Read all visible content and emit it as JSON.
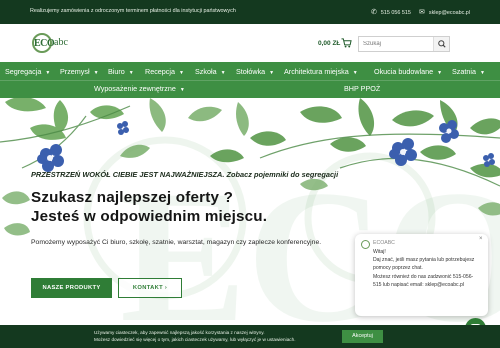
{
  "topbar": {
    "promo": "Realizujemy zamówienia z odroczonym terminem płatności dla instytucji państwowych",
    "phone": "515 056 515",
    "email": "sklep@ecoabc.pl",
    "phone_icon": "phone-icon",
    "email_icon": "envelope-icon"
  },
  "header": {
    "logo_mark": "ECO",
    "logo_suffix": "abc",
    "cart_total": "0,00 ZŁ",
    "cart_icon": "cart-icon",
    "search_placeholder": "Szukaj",
    "search_icon": "search-icon"
  },
  "nav": {
    "row1": [
      {
        "label": "Segregacja",
        "has_caret": true
      },
      {
        "label": "Przemysł",
        "has_caret": true
      },
      {
        "label": "Biuro",
        "has_caret": true
      },
      {
        "label": "Recepcja",
        "has_caret": true
      },
      {
        "label": "Szkoła",
        "has_caret": true
      },
      {
        "label": "Stołówka",
        "has_caret": true
      },
      {
        "label": "Architektura miejska",
        "has_caret": true
      },
      {
        "label": "Okucia budowlane",
        "has_caret": true
      },
      {
        "label": "Szatnia",
        "has_caret": true
      }
    ],
    "row2": [
      {
        "label": "Wyposażenie zewnętrzne",
        "has_caret": true
      },
      {
        "label": "BHP PPOŻ",
        "has_caret": false
      }
    ]
  },
  "hero": {
    "tagline": "PRZESTRZEŃ WOKÓŁ CIEBIE JEST NAJWAŻNIEJSZA. Zobacz pojemniki do segregacji",
    "heading_line1": "Szukasz najlepszej oferty ?",
    "heading_line2": "Jesteś w odpowiednim miejscu.",
    "subtitle": "Pomożemy wyposażyć Ci biuro, szkołę, szatnie, warsztat, magazyn czy zaplecze konferencyjne.",
    "primary_button": "NASZE PRODUKTY",
    "secondary_button": "KONTAKT",
    "secondary_button_icon": "chevron-right-icon",
    "watermark": "ECOabc"
  },
  "chat": {
    "sender": "ECOABC",
    "close_icon": "close-icon",
    "message": "Witaj!\nDaj znać, jeśli masz pytania lub potrzebujesz pomocy poprzez chat.\nMożesz również do nas zadzwonić 515-056-515 lub napisać email: sklep@ecoabc.pl",
    "fab_icon": "chat-bubble-icon"
  },
  "cookie": {
    "line1": "Używamy ciasteczek, aby zapewnić najlepszą jakość korzystania z naszej witryny.",
    "line2": "Możesz dowiedzieć się więcej o tym, jakich ciasteczek używamy, lub wyłączyć je w ustawieniach.",
    "accept": "Akceptuj"
  },
  "colors": {
    "dark_green": "#14391f",
    "nav_green": "#3e8f43",
    "button_green": "#2f7d36",
    "leaf_green": "#5a9a4d",
    "flower_blue": "#3b5fae"
  }
}
